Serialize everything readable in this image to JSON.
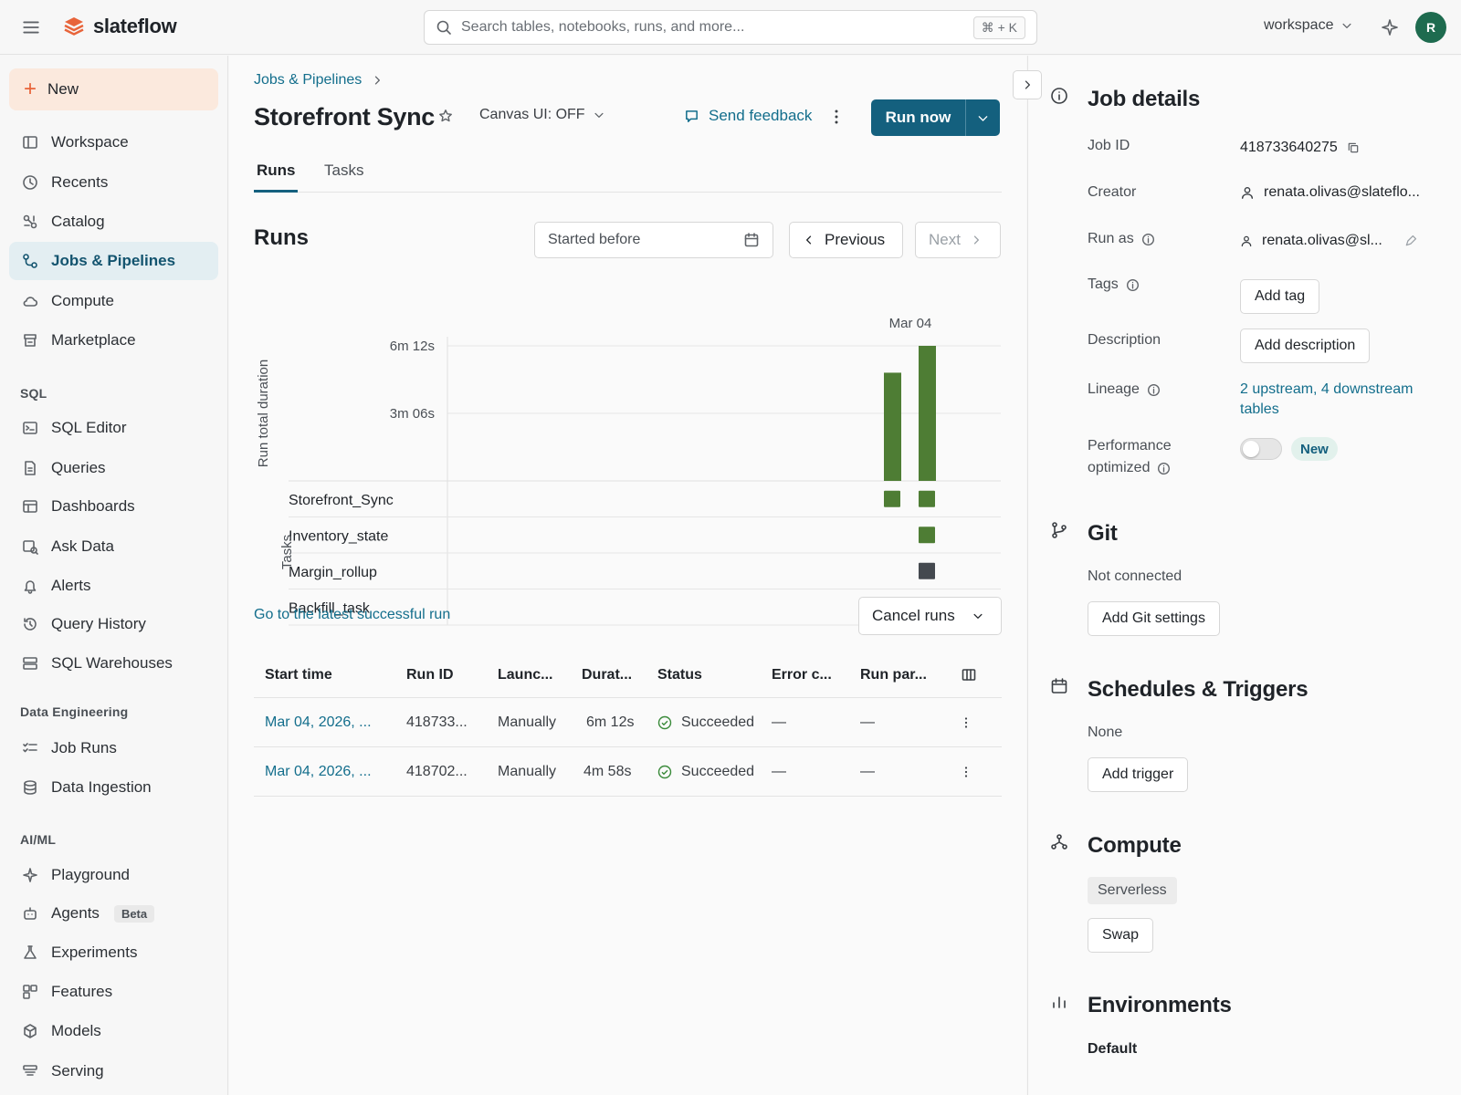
{
  "app": {
    "name": "slateflow"
  },
  "search": {
    "placeholder": "Search tables, notebooks, runs, and more...",
    "shortcut": "⌘ + K"
  },
  "topbar": {
    "workspace": "workspace",
    "avatar_initial": "R"
  },
  "sidebar": {
    "new_label": "New",
    "items": [
      {
        "label": "Workspace",
        "icon": "workspace-icon"
      },
      {
        "label": "Recents",
        "icon": "clock-icon"
      },
      {
        "label": "Catalog",
        "icon": "catalog-icon"
      },
      {
        "label": "Jobs & Pipelines",
        "icon": "workflow-icon",
        "active": true
      },
      {
        "label": "Compute",
        "icon": "cloud-icon"
      },
      {
        "label": "Marketplace",
        "icon": "store-icon"
      }
    ],
    "sql_section": "SQL",
    "sql_items": [
      {
        "label": "SQL Editor",
        "icon": "terminal-icon"
      },
      {
        "label": "Queries",
        "icon": "file-icon"
      },
      {
        "label": "Dashboards",
        "icon": "dashboard-icon"
      },
      {
        "label": "Ask Data",
        "icon": "chat-icon"
      },
      {
        "label": "Alerts",
        "icon": "bell-icon"
      },
      {
        "label": "Query History",
        "icon": "history-icon"
      },
      {
        "label": "SQL Warehouses",
        "icon": "server-icon"
      }
    ],
    "de_section": "Data Engineering",
    "de_items": [
      {
        "label": "Job Runs",
        "icon": "list-check-icon"
      },
      {
        "label": "Data Ingestion",
        "icon": "database-icon"
      }
    ],
    "ml_section": "AI/ML",
    "ml_items": [
      {
        "label": "Playground",
        "icon": "sparkle-icon"
      },
      {
        "label": "Agents",
        "icon": "robot-icon",
        "badge": "Beta"
      },
      {
        "label": "Experiments",
        "icon": "flask-icon"
      },
      {
        "label": "Features",
        "icon": "grid-icon"
      },
      {
        "label": "Models",
        "icon": "cube-icon"
      },
      {
        "label": "Serving",
        "icon": "serving-icon"
      }
    ]
  },
  "main": {
    "breadcrumb": "Jobs & Pipelines",
    "title": "Storefront Sync",
    "canvas_toggle": "Canvas UI: OFF",
    "feedback": "Send feedback",
    "run_now": "Run now",
    "tabs": [
      "Runs",
      "Tasks"
    ],
    "runs_heading": "Runs",
    "started_before": "Started before",
    "previous": "Previous",
    "next": "Next",
    "latest_link": "Go to the latest successful run",
    "cancel_runs": "Cancel runs",
    "table": {
      "headers": [
        "Start time",
        "Run ID",
        "Launc...",
        "Durat...",
        "Status",
        "Error c...",
        "Run par..."
      ],
      "rows": [
        {
          "start": "Mar 04, 2026, ...",
          "run_id": "418733...",
          "launched": "Manually",
          "duration": "6m 12s",
          "status": "Succeeded",
          "error": "—",
          "params": "—"
        },
        {
          "start": "Mar 04, 2026, ...",
          "run_id": "418702...",
          "launched": "Manually",
          "duration": "4m 58s",
          "status": "Succeeded",
          "error": "—",
          "params": "—"
        }
      ]
    }
  },
  "chart_data": {
    "type": "bar",
    "x_label": "Mar 04",
    "ylabel": "Run total duration",
    "yticks": [
      "6m 12s",
      "3m 06s"
    ],
    "ylim_seconds": [
      0,
      372
    ],
    "runs": [
      {
        "duration_seconds": 298,
        "duration_label": "4m 58s",
        "status": "Succeeded",
        "color": "#4e7d34"
      },
      {
        "duration_seconds": 372,
        "duration_label": "6m 12s",
        "status": "Succeeded",
        "color": "#4e7d34"
      }
    ],
    "task_axis_label": "Tasks",
    "tasks": [
      {
        "name": "Storefront_Sync",
        "statuses": [
          "success",
          "success"
        ]
      },
      {
        "name": "Inventory_state",
        "statuses": [
          null,
          "success"
        ]
      },
      {
        "name": "Margin_rollup",
        "statuses": [
          null,
          "neutral"
        ]
      },
      {
        "name": "Backfill_task",
        "statuses": [
          null,
          "success"
        ]
      }
    ],
    "colors": {
      "success": "#4e7d34",
      "neutral": "#44494f"
    }
  },
  "details": {
    "heading": "Job details",
    "job_id_label": "Job ID",
    "job_id": "418733640275",
    "creator_label": "Creator",
    "creator": "renata.olivas@slateflo...",
    "run_as_label": "Run as",
    "run_as": "renata.olivas@sl...",
    "tags_label": "Tags",
    "add_tag": "Add tag",
    "description_label": "Description",
    "add_description": "Add description",
    "lineage_label": "Lineage",
    "lineage_line1": "2 upstream, 4 downstream",
    "lineage_line2": "tables",
    "perf_label_1": "Performance",
    "perf_label_2": "optimized",
    "perf_badge": "New",
    "git_heading": "Git",
    "git_status": "Not connected",
    "add_git": "Add Git settings",
    "sched_heading": "Schedules & Triggers",
    "sched_status": "None",
    "add_trigger": "Add trigger",
    "compute_heading": "Compute",
    "compute_type": "Serverless",
    "swap": "Swap",
    "env_heading": "Environments",
    "env_default": "Default"
  }
}
